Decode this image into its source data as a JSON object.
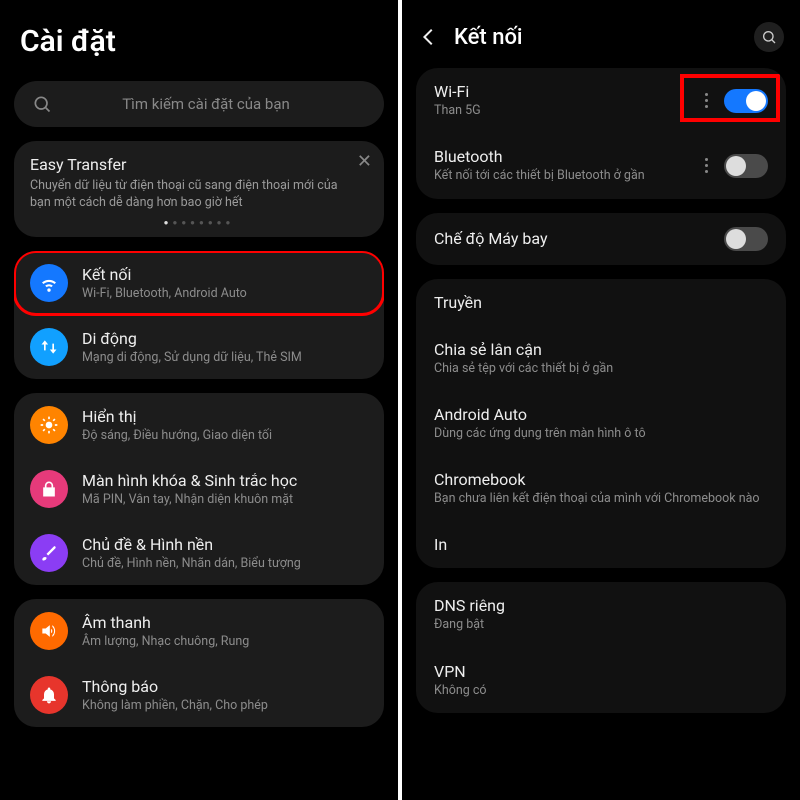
{
  "left": {
    "title": "Cài đặt",
    "search_placeholder": "Tìm kiếm cài đặt của bạn",
    "promo": {
      "title": "Easy Transfer",
      "sub": "Chuyển dữ liệu từ điện thoại cũ sang điện thoại mới của bạn một cách dễ dàng hơn bao giờ hết"
    },
    "g1": {
      "connections": {
        "title": "Kết nối",
        "sub": "Wi-Fi, Bluetooth, Android Auto"
      },
      "mobile": {
        "title": "Di động",
        "sub": "Mạng di động, Sử dụng dữ liệu, Thẻ SIM"
      }
    },
    "g2": {
      "display": {
        "title": "Hiển thị",
        "sub": "Độ sáng, Điều hướng, Giao diện tối"
      },
      "lock": {
        "title": "Màn hình khóa & Sinh trắc học",
        "sub": "Mã PIN, Vân tay, Nhận diện khuôn mặt"
      },
      "theme": {
        "title": "Chủ đề & Hình nền",
        "sub": "Chủ đề, Hình nền, Nhãn dán, Biểu tượng"
      }
    },
    "g3": {
      "sound": {
        "title": "Âm thanh",
        "sub": "Âm lượng, Nhạc chuông, Rung"
      },
      "notif": {
        "title": "Thông báo",
        "sub": "Không làm phiền, Chặn, Cho phép"
      }
    }
  },
  "right": {
    "title": "Kết nối",
    "wifi": {
      "title": "Wi-Fi",
      "sub": "Than 5G",
      "on": true
    },
    "bt": {
      "title": "Bluetooth",
      "sub": "Kết nối tới các thiết bị Bluetooth ở gần",
      "on": false
    },
    "airplane": {
      "title": "Chế độ Máy bay",
      "on": false
    },
    "cast": {
      "title": "Truyền"
    },
    "nearby": {
      "title": "Chia sẻ lân cận",
      "sub": "Chia sẻ tệp với các thiết bị ở gần"
    },
    "aauto": {
      "title": "Android Auto",
      "sub": "Dùng các ứng dụng trên màn hình ô tô"
    },
    "chromebook": {
      "title": "Chromebook",
      "sub": "Bạn chưa liên kết điện thoại của mình với Chromebook nào"
    },
    "print": {
      "title": "In"
    },
    "dns": {
      "title": "DNS riêng",
      "sub": "Đang bật"
    },
    "vpn": {
      "title": "VPN",
      "sub": "Không có"
    }
  }
}
